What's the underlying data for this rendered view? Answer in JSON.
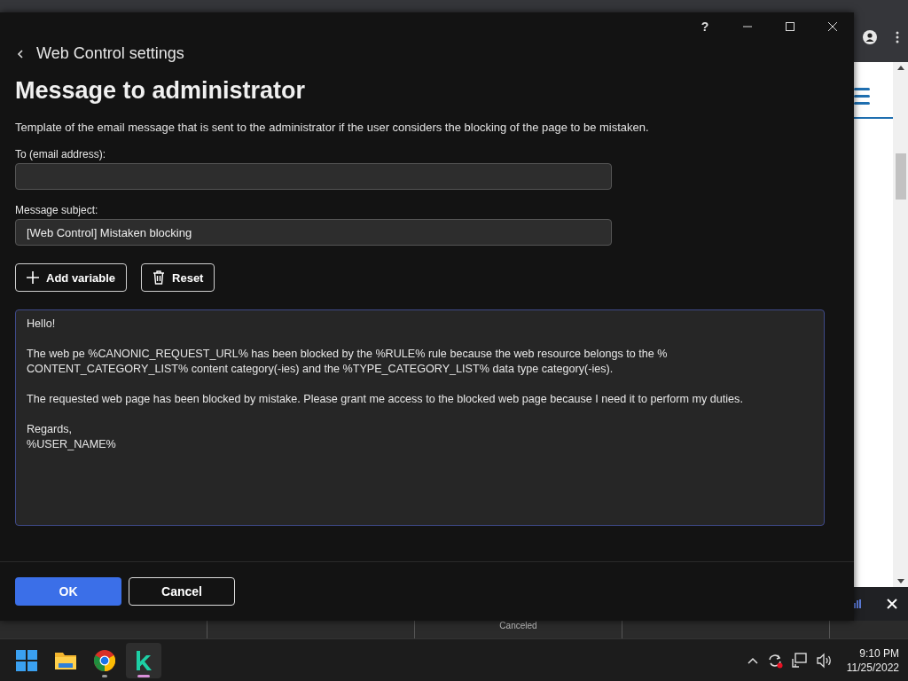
{
  "dialog": {
    "back_link": "Web Control settings",
    "title_buttons": [
      "?"
    ],
    "heading": "Message to administrator",
    "description": "Template of the email message that is sent to the administrator if the user considers the blocking of the page to be mistaken.",
    "fields": [
      {
        "label": "To (email address):"
      },
      {
        "label": "Message subject:",
        "value": "[Web Control] Mistaken blocking"
      }
    ],
    "tool_buttons": [
      {
        "kind": "add",
        "label": "Add variable"
      },
      {
        "kind": "reset",
        "label": "Reset"
      }
    ],
    "message": [
      [
        "Hello!"
      ],
      [
        "The web pe %CANONIC_REQUEST_URL% has been blocked by the %RULE% rule because the web resource belongs to the %",
        "CONTENT_CATEGORY_LIST% content category(-ies) and the %TYPE_CATEGORY_LIST% data type category(-ies)."
      ],
      [
        "The requested web page has been blocked by mistake. Please grant me access to the blocked web page because I need it to perform my duties."
      ],
      [
        "Regards,",
        "%USER_NAME%"
      ]
    ],
    "footer_buttons": [
      {
        "kind": "primary",
        "label": "OK"
      },
      {
        "kind": "secondary",
        "label": "Cancel"
      }
    ]
  },
  "background_status": "Canceled",
  "taskbar": {
    "apps": [
      {
        "kind": "start",
        "running": false
      },
      {
        "kind": "folder",
        "running": false
      },
      {
        "kind": "chrome",
        "running": true
      },
      {
        "kind": "k",
        "running": true,
        "selected": true
      }
    ],
    "time": "9:10 PM",
    "date": "11/25/2022"
  }
}
